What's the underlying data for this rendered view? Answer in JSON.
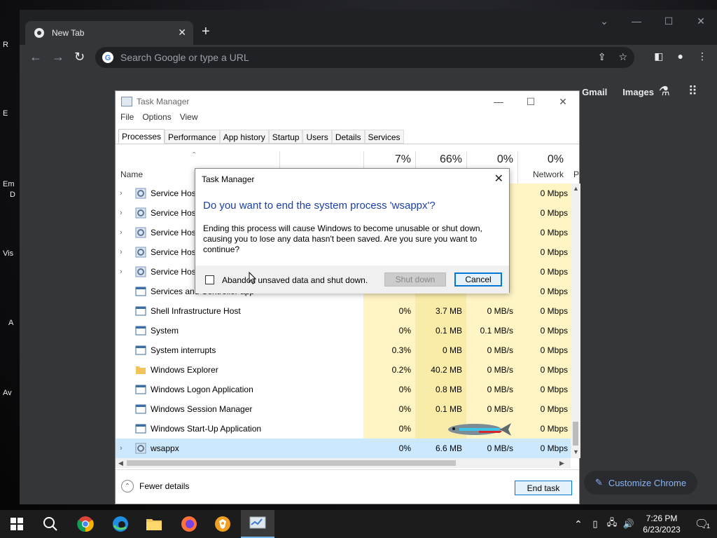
{
  "desktop": {
    "labels": [
      "R",
      "E",
      "Em",
      "D",
      "Vis",
      "A",
      "Av"
    ]
  },
  "chrome": {
    "tab_title": "New Tab",
    "omnibox_placeholder": "Search Google or type a URL",
    "ntp_links": {
      "gmail": "Gmail",
      "images": "Images"
    },
    "customize_label": "Customize Chrome",
    "accent_color": "#8ab4f8"
  },
  "task_manager": {
    "title": "Task Manager",
    "menu": {
      "file": "File",
      "options": "Options",
      "view": "View"
    },
    "tabs": [
      "Processes",
      "Performance",
      "App history",
      "Startup",
      "Users",
      "Details",
      "Services"
    ],
    "active_tab": "Processes",
    "columns": {
      "name": "Name",
      "cpu_pct": "7%",
      "memory_pct": "66%",
      "disk_pct": "0%",
      "network_pct": "0%",
      "network_label": "Network",
      "cut_label": "P"
    },
    "rows": [
      {
        "name": "Service Host",
        "expandable": true,
        "icon": "gear-icon",
        "cpu": "",
        "memory": "",
        "disk": "",
        "network": "0 Mbps"
      },
      {
        "name": "Service Host",
        "expandable": true,
        "icon": "gear-icon",
        "cpu": "",
        "memory": "",
        "disk": "",
        "network": "0 Mbps"
      },
      {
        "name": "Service Host",
        "expandable": true,
        "icon": "gear-icon",
        "cpu": "",
        "memory": "",
        "disk": "",
        "network": "0 Mbps"
      },
      {
        "name": "Service Host",
        "expandable": true,
        "icon": "gear-icon",
        "cpu": "",
        "memory": "",
        "disk": "",
        "network": "0 Mbps"
      },
      {
        "name": "Service Host",
        "expandable": true,
        "icon": "gear-icon",
        "cpu": "",
        "memory": "",
        "disk": "",
        "network": "0 Mbps"
      },
      {
        "name": "Services and Controller app",
        "expandable": false,
        "icon": "window-icon",
        "cpu": "",
        "memory": "",
        "disk": "",
        "network": "0 Mbps"
      },
      {
        "name": "Shell Infrastructure Host",
        "expandable": false,
        "icon": "window-icon",
        "cpu": "0%",
        "memory": "3.7 MB",
        "disk": "0 MB/s",
        "network": "0 Mbps"
      },
      {
        "name": "System",
        "expandable": false,
        "icon": "window-icon",
        "cpu": "0%",
        "memory": "0.1 MB",
        "disk": "0.1 MB/s",
        "network": "0 Mbps"
      },
      {
        "name": "System interrupts",
        "expandable": false,
        "icon": "window-icon",
        "cpu": "0.3%",
        "memory": "0 MB",
        "disk": "0 MB/s",
        "network": "0 Mbps"
      },
      {
        "name": "Windows Explorer",
        "expandable": false,
        "icon": "folder-icon",
        "cpu": "0.2%",
        "memory": "40.2 MB",
        "disk": "0 MB/s",
        "network": "0 Mbps"
      },
      {
        "name": "Windows Logon Application",
        "expandable": false,
        "icon": "window-icon",
        "cpu": "0%",
        "memory": "0.8 MB",
        "disk": "0 MB/s",
        "network": "0 Mbps"
      },
      {
        "name": "Windows Session Manager",
        "expandable": false,
        "icon": "window-icon",
        "cpu": "0%",
        "memory": "0.1 MB",
        "disk": "0 MB/s",
        "network": "0 Mbps"
      },
      {
        "name": "Windows Start-Up Application",
        "expandable": false,
        "icon": "window-icon",
        "cpu": "0%",
        "memory": "",
        "disk": "",
        "network": "0 Mbps"
      },
      {
        "name": "wsappx",
        "expandable": true,
        "icon": "gear-icon",
        "cpu": "0%",
        "memory": "6.6 MB",
        "disk": "0 MB/s",
        "network": "0 Mbps",
        "selected": true
      }
    ],
    "fewer_details": "Fewer details",
    "end_task": "End task"
  },
  "dialog": {
    "title": "Task Manager",
    "heading": "Do you want to end the system process 'wsappx'?",
    "body": "Ending this process will cause Windows to become unusable or shut down, causing you to lose any data hasn't been saved. Are you sure you want to continue?",
    "checkbox_label": "Abandon unsaved data and shut down.",
    "shutdown_label": "Shut down",
    "cancel_label": "Cancel",
    "heading_color": "#1c3fa8"
  },
  "taskbar": {
    "time": "7:26 PM",
    "date": "6/23/2023",
    "notification_count": "1"
  }
}
